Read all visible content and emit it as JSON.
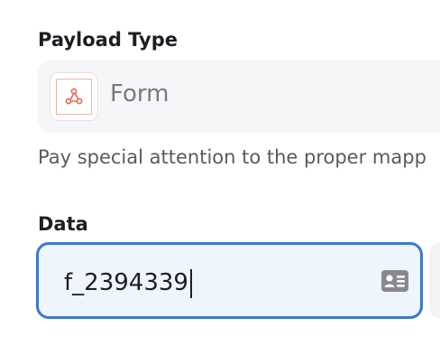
{
  "payload_type": {
    "label": "Payload Type",
    "value": "Form",
    "icon": "webhook-icon",
    "icon_color": "#e8674a"
  },
  "help_text": "Pay special attention to the proper mapp",
  "data_field": {
    "label": "Data",
    "value": "f_2394339",
    "icon": "contact-card-icon",
    "focus_color": "#3b78cf"
  }
}
